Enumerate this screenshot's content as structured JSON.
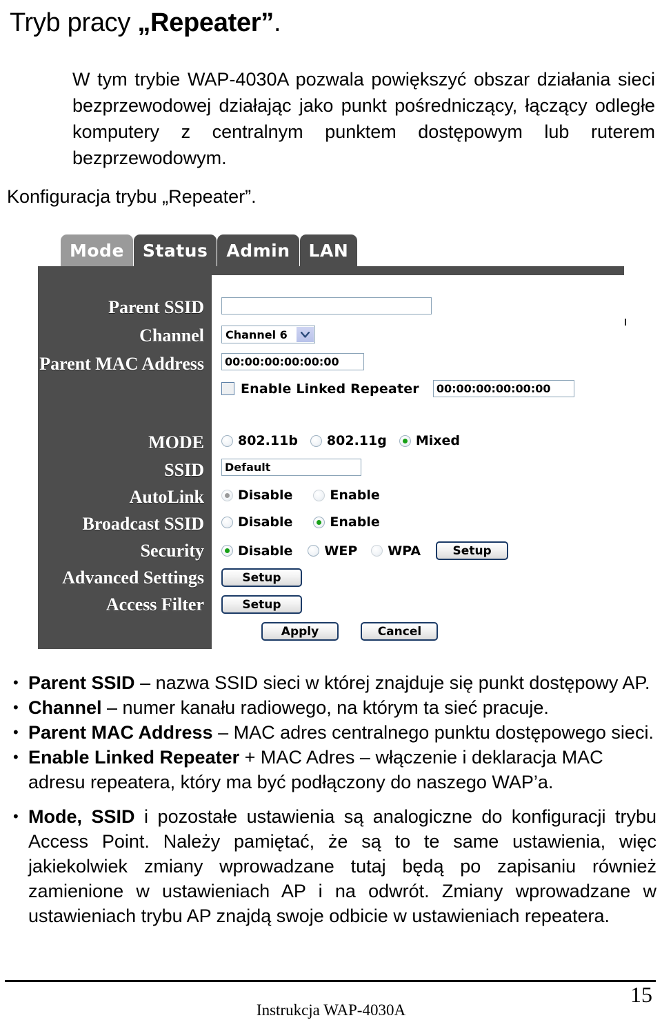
{
  "document": {
    "heading_prefix": "Tryb pracy ",
    "heading_quoted": "„Repeater”",
    "heading_suffix": ".",
    "intro_paragraph": "W tym trybie WAP-4030A pozwala powiększyć obszar działania sieci bezprzewodowej działając jako punkt pośredniczący, łączący odległe komputery z centralnym punktem dostępowym lub ruterem bezprzewodowym.",
    "config_line": "Konfiguracja trybu „Repeater”."
  },
  "router_ui": {
    "tabs": [
      {
        "label": "Mode",
        "active": true
      },
      {
        "label": "Status",
        "active": false
      },
      {
        "label": "Admin",
        "active": false
      },
      {
        "label": "LAN",
        "active": false
      }
    ],
    "labels": {
      "parent_ssid": "Parent SSID",
      "channel": "Channel",
      "parent_mac": "Parent MAC Address",
      "mode": "MODE",
      "ssid": "SSID",
      "autolink": "AutoLink",
      "broadcast_ssid": "Broadcast SSID",
      "security": "Security",
      "advanced_settings": "Advanced Settings",
      "access_filter": "Access Filter"
    },
    "fields": {
      "parent_ssid_value": "",
      "parent_ssid_placeholder": "",
      "channel_selected": "Channel 6",
      "parent_mac_value": "00:00:00:00:00:00",
      "linked_repeater_checkbox_label": "Enable Linked Repeater",
      "linked_repeater_checked": false,
      "linked_repeater_mac_value": "00:00:00:00:00:00",
      "ssid_value": "Default"
    },
    "mode_radios": [
      {
        "label": "802.11b",
        "selected": false,
        "muted": false
      },
      {
        "label": "802.11g",
        "selected": false,
        "muted": false
      },
      {
        "label": "Mixed",
        "selected": true,
        "muted": false
      }
    ],
    "autolink_radios": [
      {
        "label": "Disable",
        "selected": true,
        "muted": true
      },
      {
        "label": "Enable",
        "selected": false,
        "muted": true
      }
    ],
    "broadcast_radios": [
      {
        "label": "Disable",
        "selected": false,
        "muted": false
      },
      {
        "label": "Enable",
        "selected": true,
        "muted": false
      }
    ],
    "security_radios": [
      {
        "label": "Disable",
        "selected": true,
        "muted": false
      },
      {
        "label": "WEP",
        "selected": false,
        "muted": false
      },
      {
        "label": "WPA",
        "selected": false,
        "muted": true
      }
    ],
    "buttons": {
      "security_setup": "Setup",
      "advanced_setup": "Setup",
      "access_setup": "Setup",
      "apply": "Apply",
      "cancel": "Cancel"
    },
    "colors": {
      "panel_dark": "#4d4d4d",
      "tab_active": "#9a9a9a",
      "field_border": "#8ba4b8",
      "button_border": "#1b3a66",
      "radio_on": "#17a017",
      "dropdown_arrow_bg": "#c3cbee"
    }
  },
  "bullets": [
    {
      "bold": "Parent SSID",
      "rest": " – nazwa SSID sieci w której znajduje się punkt dostępowy AP."
    },
    {
      "bold": "Channel",
      "rest": " – numer kanału radiowego, na którym ta sieć pracuje."
    },
    {
      "bold": "Parent MAC Address",
      "rest": " – MAC adres centralnego punktu dostępowego sieci."
    },
    {
      "bold": "Enable Linked Repeater",
      "rest": " + MAC Adres – włączenie i deklaracja MAC adresu repeatera, który ma być podłączony do naszego WAP’a."
    },
    {
      "bold": "Mode, SSID",
      "rest": " i pozostałe ustawienia są analogiczne do konfiguracji trybu Access Point. Należy pamiętać, że są to te same ustawienia, więc jakiekolwiek zmiany wprowadzane tutaj będą po zapisaniu również zamienione w ustawieniach AP i na odwrót. Zmiany wprowadzane w ustawieniach trybu AP znajdą swoje odbicie w ustawieniach repeatera."
    }
  ],
  "footer": {
    "page_number": "15",
    "footer_text": "Instrukcja WAP-4030A"
  }
}
